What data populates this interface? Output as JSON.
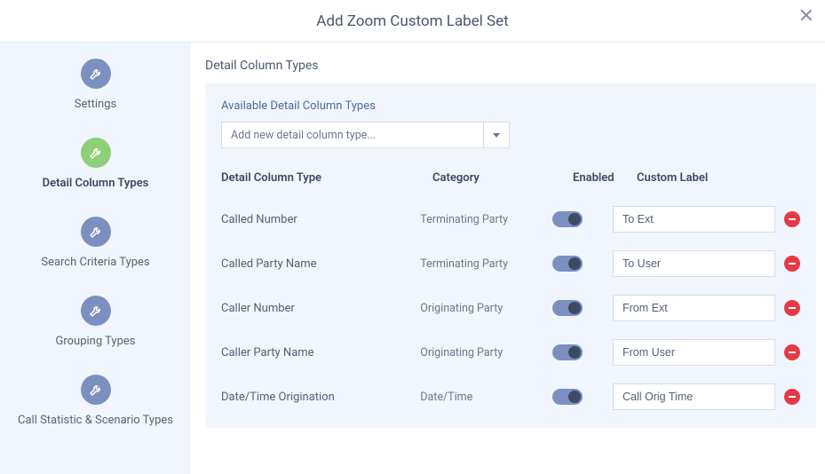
{
  "header": {
    "title": "Add Zoom Custom Label Set"
  },
  "sidebar": {
    "items": [
      {
        "label": "Settings",
        "active": false
      },
      {
        "label": "Detail Column Types",
        "active": true
      },
      {
        "label": "Search Criteria Types",
        "active": false
      },
      {
        "label": "Grouping Types",
        "active": false
      },
      {
        "label": "Call Statistic & Scenario Types",
        "active": false
      }
    ]
  },
  "section": {
    "title": "Detail Column Types",
    "available_label": "Available Detail Column Types",
    "select_placeholder": "Add new detail column type...",
    "columns": {
      "type": "Detail Column Type",
      "category": "Category",
      "enabled": "Enabled",
      "custom_label": "Custom Label"
    },
    "rows": [
      {
        "name": "Called Number",
        "category": "Terminating Party",
        "enabled": true,
        "label": "To Ext"
      },
      {
        "name": "Called Party Name",
        "category": "Terminating Party",
        "enabled": true,
        "label": "To User"
      },
      {
        "name": "Caller Number",
        "category": "Originating Party",
        "enabled": true,
        "label": "From Ext"
      },
      {
        "name": "Caller Party Name",
        "category": "Originating Party",
        "enabled": true,
        "label": "From User"
      },
      {
        "name": "Date/Time Origination",
        "category": "Date/Time",
        "enabled": true,
        "label": "Call Orig Time"
      }
    ]
  }
}
